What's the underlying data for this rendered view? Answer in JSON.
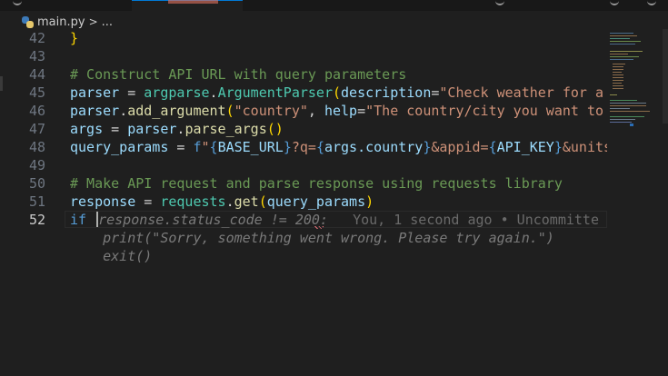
{
  "breadcrumb": {
    "file": "main.py",
    "separator": ">",
    "more": "..."
  },
  "editor": {
    "lines": [
      {
        "num": "42"
      },
      {
        "num": "43"
      },
      {
        "num": "44"
      },
      {
        "num": "45"
      },
      {
        "num": "46"
      },
      {
        "num": "47"
      },
      {
        "num": "48"
      },
      {
        "num": "49"
      },
      {
        "num": "50"
      },
      {
        "num": "51"
      },
      {
        "num": "52"
      },
      {
        "num": ""
      },
      {
        "num": ""
      }
    ],
    "tokens": {
      "l42": "}",
      "l44": "# Construct API URL with query parameters",
      "l45_a": "parser",
      "l45_b": " = ",
      "l45_c": "argparse",
      "l45_d": ".",
      "l45_e": "ArgumentParser",
      "l45_f": "(",
      "l45_g": "description",
      "l45_h": "=",
      "l45_i": "\"Check weather for a c",
      "l46_a": "parser",
      "l46_b": ".",
      "l46_c": "add_argument",
      "l46_d": "(",
      "l46_e": "\"country\"",
      "l46_f": ", ",
      "l46_g": "help",
      "l46_h": "=",
      "l46_i": "\"The country/city you want to c",
      "l47_a": "args",
      "l47_b": " = ",
      "l47_c": "parser",
      "l47_d": ".",
      "l47_e": "parse_args",
      "l47_f": "()",
      "l48_a": "query_params",
      "l48_b": " = ",
      "l48_c": "f",
      "l48_d": "\"",
      "l48_e": "{",
      "l48_f": "BASE_URL",
      "l48_g": "}",
      "l48_h": "?q=",
      "l48_i": "{",
      "l48_j": "args.country",
      "l48_k": "}",
      "l48_l": "&appid=",
      "l48_m": "{",
      "l48_n": "API_KEY",
      "l48_o": "}",
      "l48_p": "&units=",
      "l50": "# Make API request and parse response using requests library",
      "l51_a": "response",
      "l51_b": " = ",
      "l51_c": "requests",
      "l51_d": ".",
      "l51_e": "get",
      "l51_f": "(",
      "l51_g": "query_params",
      "l51_h": ")",
      "l52_kw": "if",
      "l52_ghost": "response.status_code != 200:",
      "l52_blame": "You, 1 second ago • Uncommitte",
      "l53_ghost": "    print(\"Sorry, something went wrong. Please try again.\")",
      "l54_ghost": "    exit()"
    }
  },
  "icons": {
    "file_type": "python-file-icon"
  },
  "colors": {
    "background": "#1f1f1f",
    "accent": "#0078d4",
    "keyword": "#569cd6",
    "string": "#ce9178",
    "comment": "#6a9955"
  }
}
